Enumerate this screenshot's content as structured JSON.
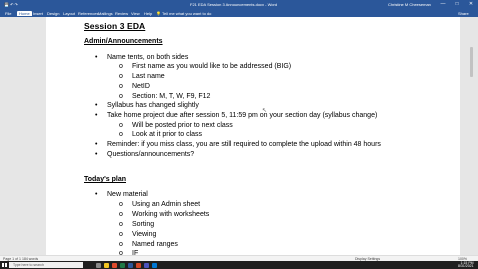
{
  "window": {
    "title": "F21 EDA Session 3 Announcements.docx - Word",
    "user": "Christine M Cheeseman",
    "controls": [
      "—",
      "□",
      "✕"
    ]
  },
  "menu": {
    "file": "File",
    "home": "Home",
    "insert": "Insert",
    "design": "Design",
    "layout": "Layout",
    "references": "References",
    "mailings": "Mailings",
    "review": "Review",
    "view": "View",
    "help": "Help",
    "tell_me": "Tell me what you want to do",
    "share": "Share"
  },
  "document": {
    "title": "Session 3 EDA",
    "sections": [
      {
        "heading": "Admin/Announcements",
        "items": [
          {
            "level": 1,
            "text": "Name tents, on both sides"
          },
          {
            "level": 2,
            "text": "First name as you would like to be addressed (BIG)"
          },
          {
            "level": 2,
            "text": "Last name"
          },
          {
            "level": 2,
            "text": "NetID"
          },
          {
            "level": 2,
            "text": "Section:  M, T, W, F9, F12"
          },
          {
            "level": 1,
            "text": "Syllabus has changed slightly"
          },
          {
            "level": 1,
            "text": "Take home project due after session 5, 11:59 pm on your section day (syllabus change)"
          },
          {
            "level": 2,
            "text": "Will be posted prior to next class"
          },
          {
            "level": 2,
            "text": "Look at it prior to class"
          },
          {
            "level": 1,
            "text": "Reminder:  if you miss class, you are still required to complete the upload within 48 hours"
          },
          {
            "level": 1,
            "text": "Questions/announcements?"
          }
        ]
      },
      {
        "heading": "Today's plan",
        "items": [
          {
            "level": 1,
            "text": "New material"
          },
          {
            "level": 2,
            "text": "Using an Admin sheet"
          },
          {
            "level": 2,
            "text": "Working with worksheets"
          },
          {
            "level": 2,
            "text": "Sorting"
          },
          {
            "level": 2,
            "text": "Viewing"
          },
          {
            "level": 2,
            "text": "Named ranges"
          },
          {
            "level": 2,
            "text": "IF"
          }
        ]
      }
    ]
  },
  "status": {
    "page": "Page 1 of 1",
    "words": "184 words",
    "display_settings": "Display Settings",
    "zoom": "100%"
  },
  "taskbar": {
    "search_placeholder": "Type here to search",
    "time": "1:15 PM",
    "date": "8/31/2021"
  }
}
